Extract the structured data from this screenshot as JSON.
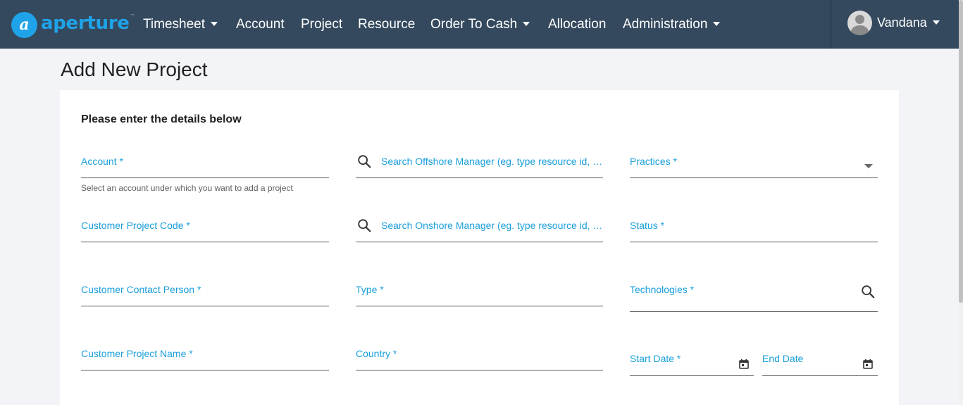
{
  "brand": {
    "name": "aperture",
    "mark": "a",
    "tm": "™"
  },
  "nav": {
    "items": [
      {
        "label": "Timesheet",
        "dropdown": true
      },
      {
        "label": "Account",
        "dropdown": false
      },
      {
        "label": "Project",
        "dropdown": false
      },
      {
        "label": "Resource",
        "dropdown": false
      },
      {
        "label": "Order To Cash",
        "dropdown": true
      },
      {
        "label": "Allocation",
        "dropdown": false
      },
      {
        "label": "Administration",
        "dropdown": true
      }
    ],
    "user": {
      "name": "Vandana"
    }
  },
  "page": {
    "title": "Add New Project"
  },
  "form": {
    "heading": "Please enter the details below",
    "account": {
      "label": "Account *",
      "helper": "Select an account under which you want to add a project"
    },
    "offshore_manager": {
      "label": "Search Offshore Manager (eg. type resource id, r..."
    },
    "practices": {
      "label": "Practices *"
    },
    "customer_project_code": {
      "label": "Customer Project Code *"
    },
    "onshore_manager": {
      "label": "Search Onshore Manager (eg. type resource id, r..."
    },
    "status": {
      "label": "Status *"
    },
    "customer_contact_person": {
      "label": "Customer Contact Person *"
    },
    "type": {
      "label": "Type *"
    },
    "technologies": {
      "label": "Technologies *"
    },
    "customer_project_name": {
      "label": "Customer Project Name *"
    },
    "country": {
      "label": "Country *"
    },
    "start_date": {
      "label": "Start Date *"
    },
    "end_date": {
      "label": "End Date"
    }
  },
  "colors": {
    "nav_bg": "#34495e",
    "accent": "#1a9fdc",
    "brand": "#1fa3e8"
  }
}
